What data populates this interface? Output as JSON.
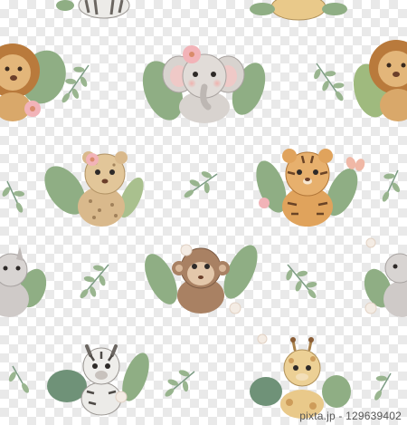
{
  "image": {
    "background": "transparency-checkerboard",
    "pattern": "watercolor baby safari animals with tropical leaves",
    "animals": [
      "zebra",
      "giraffe",
      "lion",
      "elephant",
      "leopard",
      "tiger",
      "rhino",
      "monkey"
    ]
  },
  "watermark": {
    "text": "pixta.jp - 129639402"
  },
  "colors": {
    "leaf": "#8fae84",
    "leaf_dark": "#6f9278",
    "flower": "#f2b3b8",
    "lion": "#d9a86a",
    "lion_mane": "#b97a3c",
    "elephant": "#d8d3cf",
    "leopard": "#d9b98c",
    "tiger": "#e0a35c",
    "rhino": "#cfcac8",
    "monkey": "#a98163",
    "giraffe": "#e9c98a",
    "zebra": "#ecebe8"
  }
}
